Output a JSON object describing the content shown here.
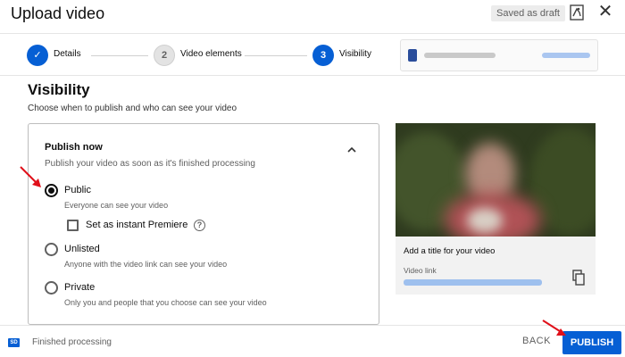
{
  "header": {
    "title": "Upload video",
    "draft_status": "Saved as draft"
  },
  "stepper": {
    "steps": [
      {
        "number": "1",
        "label": "Details",
        "state": "completed"
      },
      {
        "number": "2",
        "label": "Video elements",
        "state": "pending"
      },
      {
        "number": "3",
        "label": "Visibility",
        "state": "active"
      }
    ]
  },
  "visibility": {
    "title": "Visibility",
    "description": "Choose when to publish and who can see your video",
    "publish_now": {
      "title": "Publish now",
      "description": "Publish your video as soon as it's finished processing",
      "selected": "Public",
      "options": [
        {
          "label": "Public",
          "description": "Everyone can see your video"
        },
        {
          "label": "Unlisted",
          "description": "Anyone with the video link can see your video"
        },
        {
          "label": "Private",
          "description": "Only you and people that you choose can see your video"
        }
      ],
      "premiere_label": "Set as instant Premiere",
      "premiere_checked": false
    }
  },
  "video_preview": {
    "title_placeholder": "Add a title for your video",
    "link_label": "Video link"
  },
  "footer": {
    "status": "Finished processing",
    "quality_badge": "SD",
    "back_label": "BACK",
    "publish_label": "PUBLISH"
  },
  "colors": {
    "accent": "#065fd4",
    "annotation_arrow": "#e0101a"
  }
}
